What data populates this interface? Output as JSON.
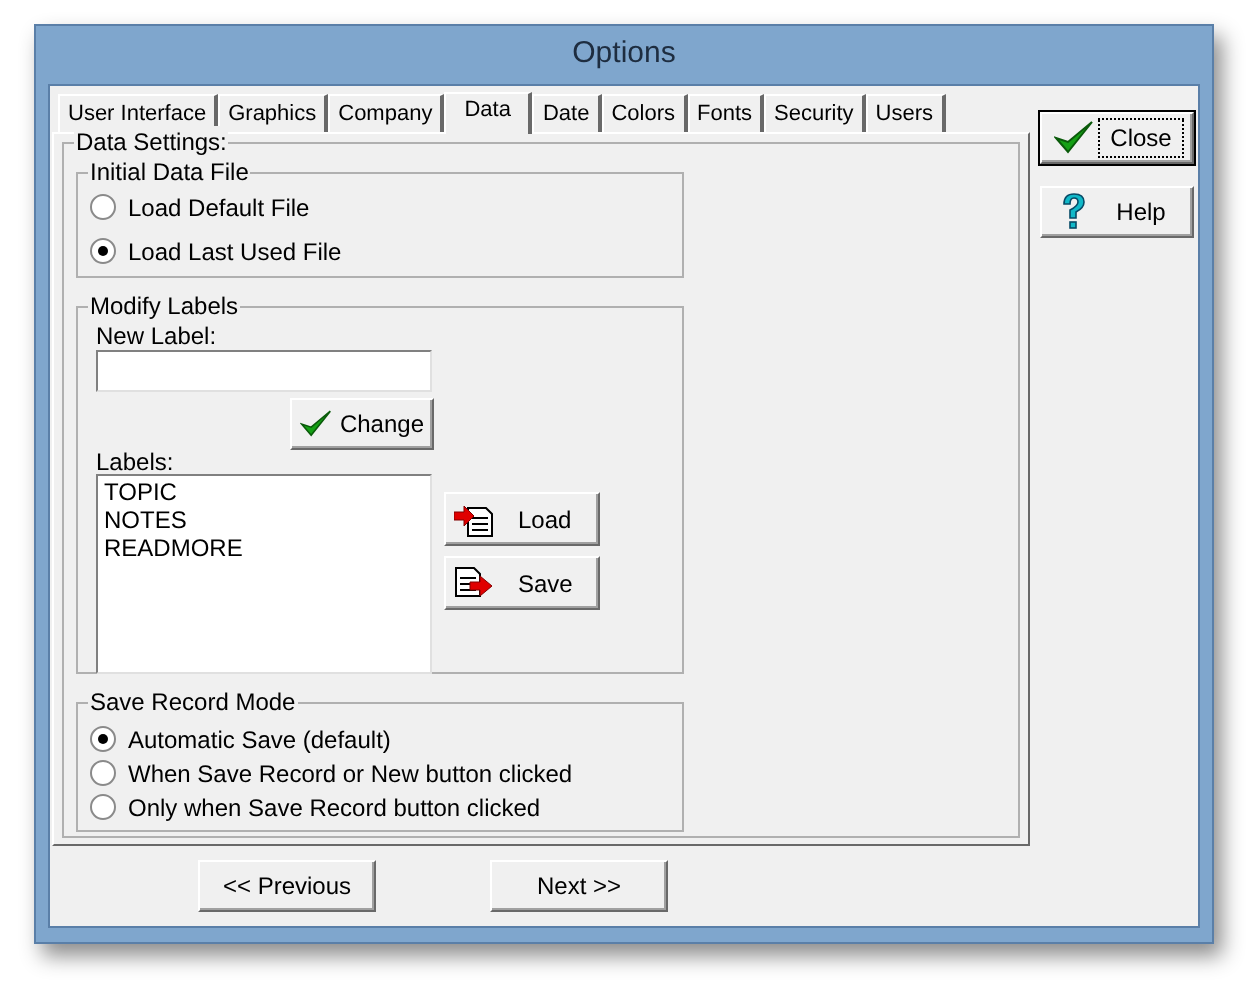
{
  "window": {
    "title": "Options"
  },
  "tabs": [
    {
      "label": "User Interface",
      "selected": false
    },
    {
      "label": "Graphics",
      "selected": false
    },
    {
      "label": "Company",
      "selected": false
    },
    {
      "label": "Data",
      "selected": true
    },
    {
      "label": "Date",
      "selected": false
    },
    {
      "label": "Colors",
      "selected": false
    },
    {
      "label": "Fonts",
      "selected": false
    },
    {
      "label": "Security",
      "selected": false
    },
    {
      "label": "Users",
      "selected": false
    }
  ],
  "data_settings": {
    "title": "Data Settings:",
    "initial_data_file": {
      "title": "Initial Data File",
      "options": [
        {
          "label": "Load Default File",
          "selected": false
        },
        {
          "label": "Load Last Used File",
          "selected": true
        }
      ]
    },
    "modify_labels": {
      "title": "Modify Labels",
      "new_label": "New Label:",
      "change_button": "Change",
      "labels_caption": "Labels:",
      "labels": [
        "TOPIC",
        "NOTES",
        "READMORE"
      ],
      "load_button": "Load",
      "save_button": "Save"
    },
    "save_record_mode": {
      "title": "Save Record Mode",
      "options": [
        {
          "label": "Automatic Save (default)",
          "selected": true
        },
        {
          "label": "When Save Record or New button clicked",
          "selected": false
        },
        {
          "label": "Only when Save Record button clicked",
          "selected": false
        }
      ]
    }
  },
  "side_buttons": [
    {
      "kind": "close",
      "label": "Close",
      "focused": true
    },
    {
      "kind": "help",
      "label": "Help",
      "focused": false
    }
  ],
  "nav_buttons": [
    "<< Previous",
    "Next >>"
  ]
}
